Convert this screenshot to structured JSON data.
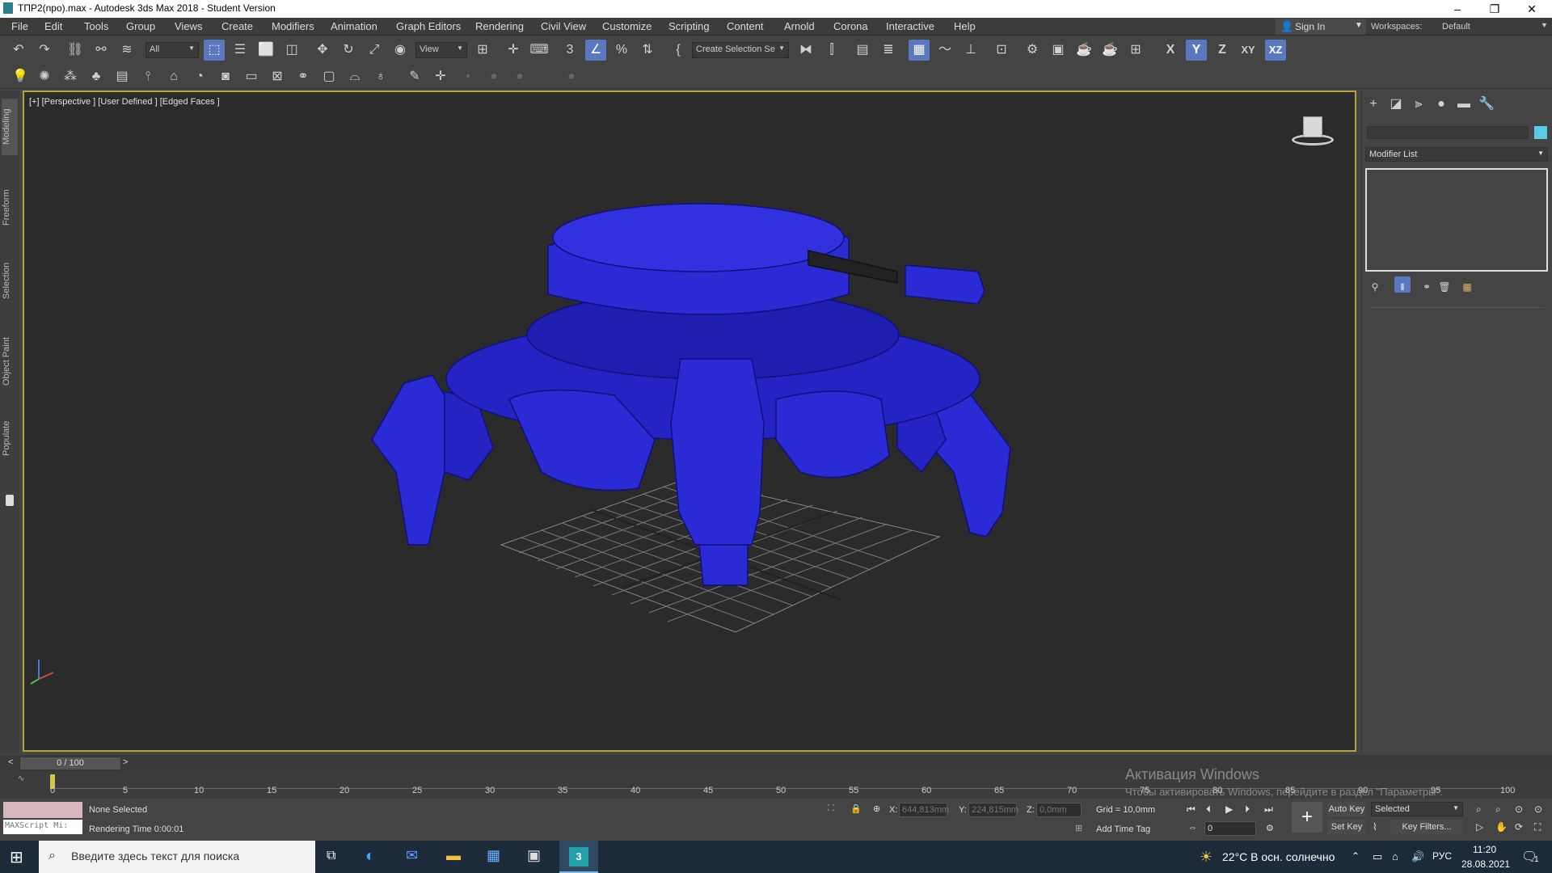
{
  "window": {
    "title": "TПР2(npo).max - Autodesk 3ds Max 2018 - Student Version"
  },
  "menu": [
    "File",
    "Edit",
    "Tools",
    "Group",
    "Views",
    "Create",
    "Modifiers",
    "Animation",
    "Graph Editors",
    "Rendering",
    "Civil View",
    "Customize",
    "Scripting",
    "Content",
    "Arnold",
    "Corona",
    "Interactive",
    "Help"
  ],
  "account": {
    "signin": "Sign In",
    "workspaces_label": "Workspaces:",
    "workspace": "Default"
  },
  "toolbar": {
    "filter": "All",
    "ref_coord": "View",
    "selection_set": "Create Selection Se",
    "axes": [
      "X",
      "Y",
      "Z",
      "XY",
      "XZ"
    ]
  },
  "left_tabs": [
    "Modeling",
    "Freeform",
    "Selection",
    "Object Paint",
    "Populate"
  ],
  "viewport": {
    "label": "[+] [Perspective ] [User Defined ] [Edged Faces ]"
  },
  "command_panel": {
    "modifier_list": "Modifier List"
  },
  "timeline": {
    "frame": "0 / 100",
    "ticks": [
      "0",
      "5",
      "10",
      "15",
      "20",
      "25",
      "30",
      "35",
      "40",
      "45",
      "50",
      "55",
      "60",
      "65",
      "70",
      "75",
      "80",
      "85",
      "90",
      "95",
      "100"
    ]
  },
  "status": {
    "selection": "None Selected",
    "render_time": "Rendering Time  0:00:01",
    "maxscript": "MAXScript Mi:",
    "x_label": "X:",
    "x": "644,813mm",
    "y_label": "Y:",
    "y": "224,815mm",
    "z_label": "Z:",
    "z": "0,0mm",
    "grid": "Grid = 10,0mm",
    "add_time_tag": "Add Time Tag",
    "auto_key": "Auto Key",
    "set_key": "Set Key",
    "selected": "Selected",
    "key_filters": "Key Filters...",
    "frame_field": "0"
  },
  "activation": {
    "title": "Активация Windows",
    "sub": "Чтобы активировать Windows, перейдите в раздел \"Параметры\"."
  },
  "taskbar": {
    "search_placeholder": "Введите здесь текст для поиска",
    "weather": "22°C  В осн. солнечно",
    "lang": "РУС",
    "time": "11:20",
    "date": "28.08.2021",
    "notif_count": "1"
  },
  "colors": {
    "accent": "#5a78c0",
    "model": "#2b2bd6",
    "viewport_border": "#b8a23c"
  }
}
